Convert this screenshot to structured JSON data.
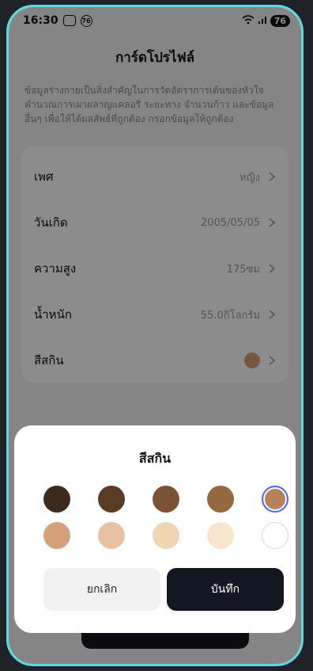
{
  "status_bar": {
    "time": "16:30",
    "icon1": "⊡",
    "icon2": "76",
    "battery": "76"
  },
  "page": {
    "title": "การ์ดโปรไฟล์",
    "description": "ข้อมูลร่างกายเป็นสิ่งสำคัญในการวัดอัตราการเต้นของหัวใจ คำนวณการเผาผลาญแคลอรี่ ระยะทาง จำนวนก้าว และข้อมูลอื่นๆ เพื่อให้ได้ผลลัพธ์ที่ถูกต้อง กรอกข้อมูลให้ถูกต้อง"
  },
  "profile": {
    "rows": [
      {
        "label": "เพศ",
        "value": "หญิง"
      },
      {
        "label": "วันเกิด",
        "value": "2005/05/05"
      },
      {
        "label": "ความสูง",
        "value": "175ซม"
      },
      {
        "label": "น้ำหนัก",
        "value": "55.0กิโลกรัม"
      },
      {
        "label": "สีสกิน",
        "value": ""
      }
    ],
    "skin_current_color": "#d3a07a"
  },
  "sheet": {
    "title": "สีสกิน",
    "swatches": [
      "#3d2a1e",
      "#5a3b27",
      "#7a5236",
      "#96683f",
      "#b5825c",
      "#d3a07a",
      "#e8c2a0",
      "#f0d5b3",
      "#f7e6cd",
      "#ffffff"
    ],
    "selected_index": 4,
    "cancel_label": "ยกเลิก",
    "save_label": "บันทึก"
  }
}
